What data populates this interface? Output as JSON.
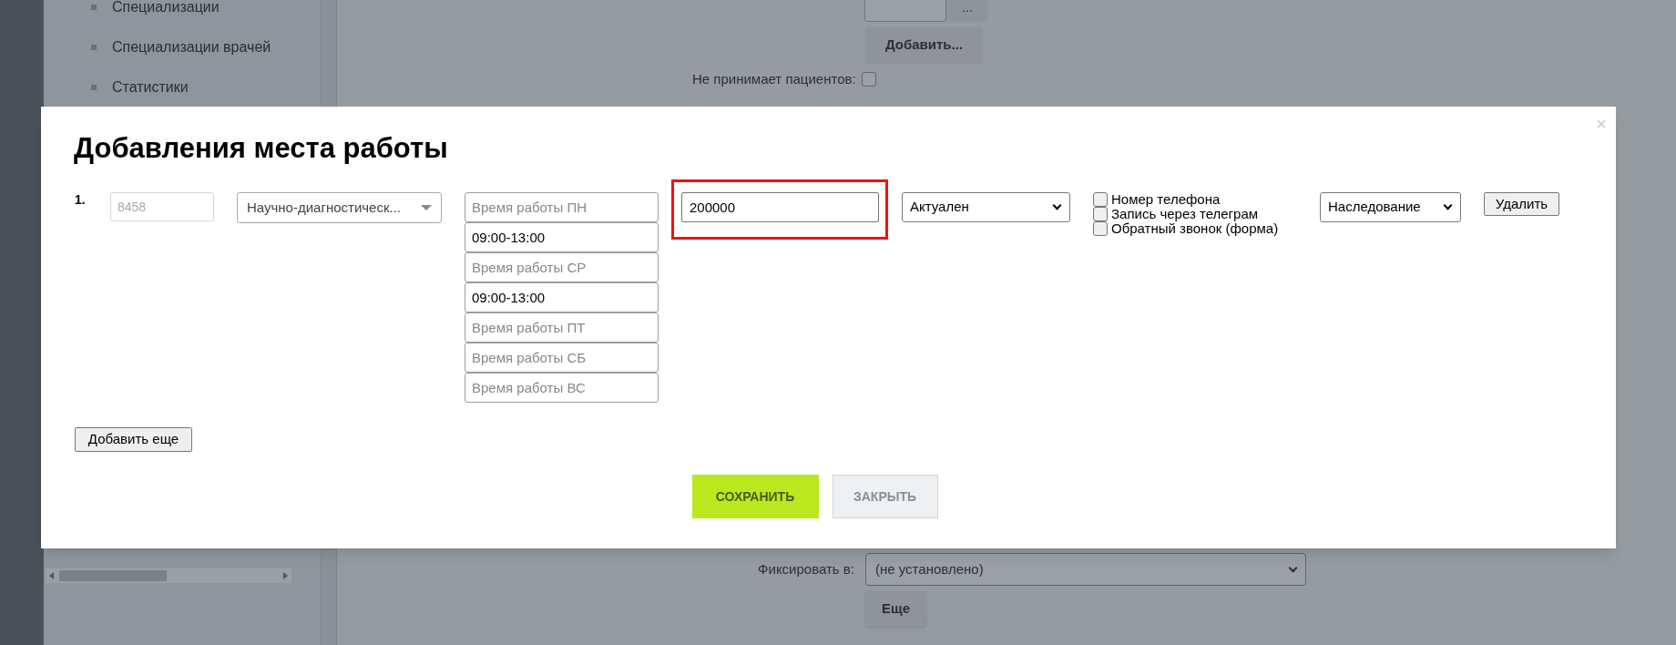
{
  "sidebar": {
    "items": [
      {
        "label": "Специализации"
      },
      {
        "label": "Специализации врачей"
      },
      {
        "label": "Статистики"
      }
    ]
  },
  "background_form": {
    "browse_button": "...",
    "add_button": "Добавить...",
    "no_patients_label": "Не принимает пациентов:",
    "no_patients_checked": false,
    "fix_label": "Фиксировать в:",
    "fix_select": "(не установлено)",
    "more_button": "Еще"
  },
  "modal": {
    "close": "×",
    "title": "Добавления места работы",
    "rows": [
      {
        "number": "1.",
        "id_field": {
          "placeholder": "8458"
        },
        "clinic_select": "Научно-диагностическ...",
        "hours": [
          {
            "placeholder": "Время работы ПН"
          },
          {
            "value": "09:00-13:00"
          },
          {
            "placeholder": "Время работы СР"
          },
          {
            "value": "09:00-13:00"
          },
          {
            "placeholder": "Время работы ПТ"
          },
          {
            "placeholder": "Время работы СБ"
          },
          {
            "placeholder": "Время работы ВС"
          }
        ],
        "price_field": {
          "value": "200000",
          "highlighted": true
        },
        "status_select": "Актуален",
        "options": [
          {
            "label": "Номер телефона",
            "checked": false
          },
          {
            "label": "Запись через телеграм",
            "checked": false
          },
          {
            "label": "Обратный звонок (форма)",
            "checked": false
          }
        ],
        "type_select": "Наследование",
        "delete_button": "Удалить"
      }
    ],
    "add_more_button": "Добавить еще",
    "save_button": "СОХРАНИТЬ",
    "close_button": "ЗАКРЫТЬ"
  }
}
